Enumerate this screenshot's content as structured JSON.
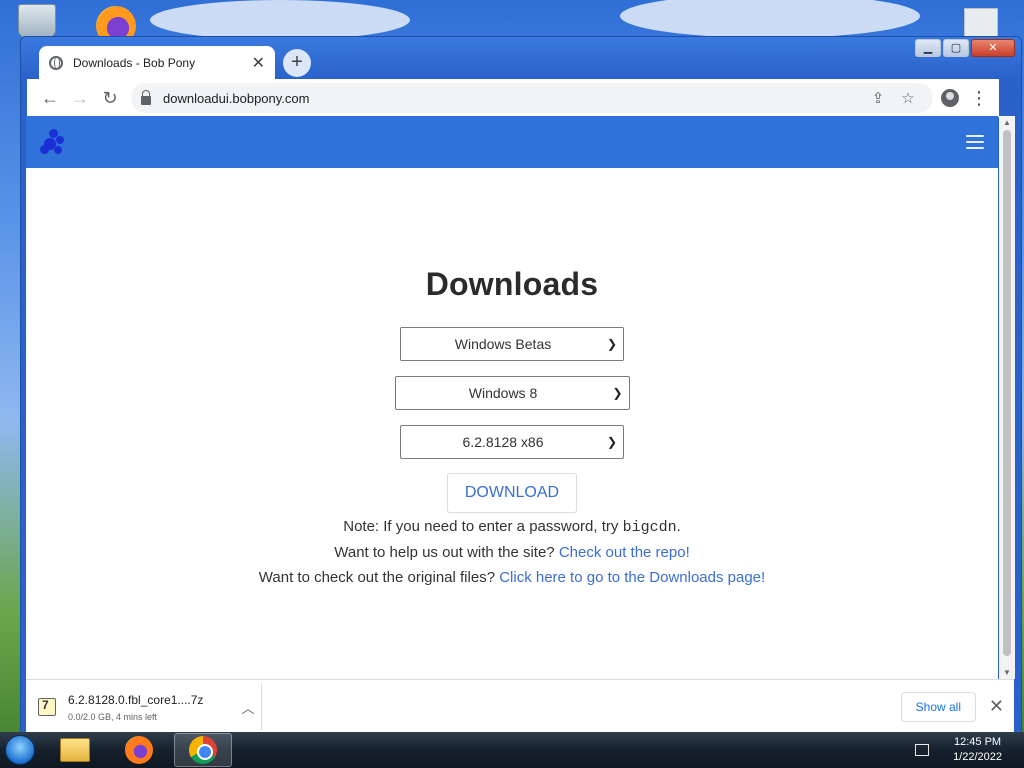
{
  "browser": {
    "tab_title": "Downloads - Bob Pony",
    "tab_close": "✕",
    "new_tab": "+",
    "url": "downloadui.bobpony.com",
    "window_buttons": {
      "minimize": "▁",
      "maximize": "▢",
      "close": "✕"
    }
  },
  "page": {
    "heading": "Downloads",
    "selects": {
      "category": "Windows Betas",
      "os": "Windows 8",
      "build": "6.2.8128 x86"
    },
    "download_button": "DOWNLOAD",
    "note_prefix": "Note: If you need to enter a password, try ",
    "note_code": "bigcdn",
    "note_suffix": ".",
    "help_prefix": "Want to help us out with the site? ",
    "help_link": "Check out the repo!",
    "original_prefix": "Want to check out the original files? ",
    "original_link": "Click here to go to the Downloads page!"
  },
  "download_shelf": {
    "filename": "6.2.8128.0.fbl_core1....7z",
    "status": "0.0/2.0 GB, 4 mins left",
    "show_all": "Show all",
    "close": "✕"
  },
  "taskbar": {
    "time": "12:45 PM",
    "date": "1/22/2022"
  },
  "colors": {
    "site_navbar": "#2f72d9",
    "link": "#3a6fd1",
    "window_frame": "#2a62c9"
  }
}
